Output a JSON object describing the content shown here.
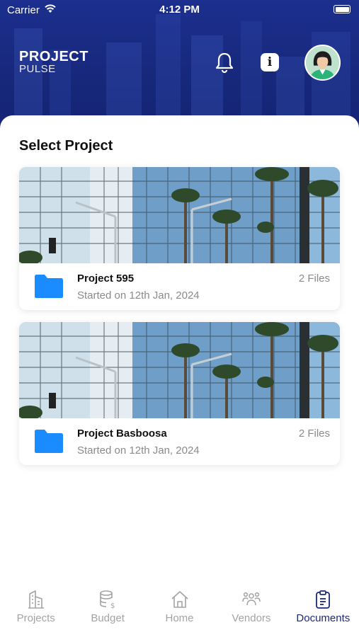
{
  "status_bar": {
    "carrier": "Carrier",
    "time": "4:12 PM"
  },
  "header": {
    "logo_line1": "PROJECT",
    "logo_line2": "PULSE"
  },
  "main": {
    "title": "Select Project",
    "projects": [
      {
        "name": "Project 595",
        "started": "Started on 12th Jan, 2024",
        "files": "2 Files"
      },
      {
        "name": "Project Basboosa",
        "started": "Started on 12th Jan, 2024",
        "files": "2 Files"
      }
    ]
  },
  "nav": {
    "items": [
      {
        "label": "Projects",
        "icon": "building-icon"
      },
      {
        "label": "Budget",
        "icon": "coins-icon"
      },
      {
        "label": "Home",
        "icon": "home-icon"
      },
      {
        "label": "Vendors",
        "icon": "people-icon"
      },
      {
        "label": "Documents",
        "icon": "clipboard-icon",
        "active": true
      }
    ]
  },
  "colors": {
    "header": "#1c2f8e",
    "accent": "#1c2a78",
    "folder": "#1a8cff",
    "muted": "#8a8a8a"
  }
}
